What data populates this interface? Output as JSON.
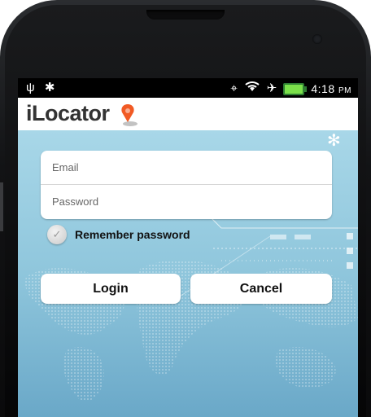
{
  "statusbar": {
    "left_icons": [
      "usb-icon",
      "android-debug-icon"
    ],
    "right_icons": [
      "gps-icon",
      "wifi-icon",
      "airplane-icon",
      "battery-icon"
    ],
    "time": "4:18",
    "ampm": "PM"
  },
  "app": {
    "name": "iLocator"
  },
  "login": {
    "email_placeholder": "Email",
    "password_placeholder": "Password",
    "remember_label": "Remember password",
    "remember_checked": false,
    "login_label": "Login",
    "cancel_label": "Cancel"
  },
  "colors": {
    "background_blue": "#9fd0e3",
    "logo_pin_orange": "#f15a24",
    "battery_green": "#7be04a"
  }
}
